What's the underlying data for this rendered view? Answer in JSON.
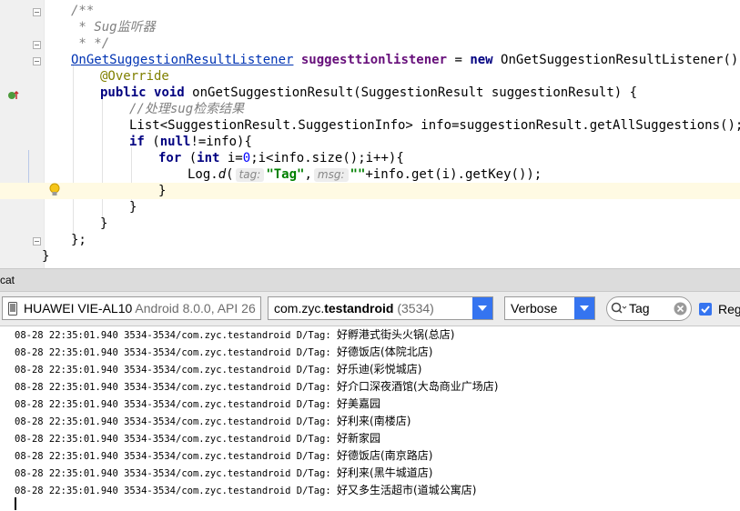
{
  "editor": {
    "comment_open": "/**",
    "comment_mid": " * Sug监听器",
    "comment_close": " * */",
    "l4_type": "OnGetSuggestionResultListener",
    "l4_field": "suggesttionlistener",
    "l4_eq": " = ",
    "l4_new": "new",
    "l4_rest": " OnGetSuggestionResultListener() {",
    "l5_annotation": "@Override",
    "l6_public": "public",
    "l6_void": "void",
    "l6_rest": " onGetSuggestionResult(SuggestionResult suggestionResult) {",
    "l7_comment": "//处理sug检索结果",
    "l8_text": "List<SuggestionResult.SuggestionInfo> info=suggestionResult.getAllSuggestions();",
    "l9_if": "if",
    "l9_null": "null",
    "l9_rest": "!=info){",
    "l9_open": " (",
    "l10_for": "for",
    "l10_int": "int",
    "l10_a": " (",
    "l10_b": " i=",
    "l10_zero": "0",
    "l10_c": ";i<info.size();i++){",
    "l11_a": "Log.",
    "l11_d": "d",
    "l11_paren": "(",
    "l11_hint_tag": "tag:",
    "l11_tag": "\"Tag\"",
    "l11_comma": ",",
    "l11_hint_msg": "msg:",
    "l11_empty": "\"\"",
    "l11_rest": "+info.get(i).getKey());",
    "l12": "}",
    "l13": "}",
    "l14": "}",
    "l15": "};",
    "l16": "}"
  },
  "logcat": {
    "title": "cat",
    "device": {
      "name": "HUAWEI VIE-AL10",
      "detail": "Android 8.0.0, API 26"
    },
    "process": {
      "prefix": "com.zyc.",
      "bold": "testandroid",
      "pid": "(3534)"
    },
    "level": "Verbose",
    "search": {
      "value": "Tag"
    },
    "regex_label": "Regex",
    "lines": [
      {
        "meta": "08-28 22:35:01.940 3534-3534/com.zyc.testandroid D/Tag: ",
        "msg": "好孵港式街头火锅(总店)"
      },
      {
        "meta": "08-28 22:35:01.940 3534-3534/com.zyc.testandroid D/Tag: ",
        "msg": "好德饭店(体院北店)"
      },
      {
        "meta": "08-28 22:35:01.940 3534-3534/com.zyc.testandroid D/Tag: ",
        "msg": "好乐迪(彩悦城店)"
      },
      {
        "meta": "08-28 22:35:01.940 3534-3534/com.zyc.testandroid D/Tag: ",
        "msg": "好介口深夜酒馆(大岛商业广场店)"
      },
      {
        "meta": "08-28 22:35:01.940 3534-3534/com.zyc.testandroid D/Tag: ",
        "msg": "好美嘉园"
      },
      {
        "meta": "08-28 22:35:01.940 3534-3534/com.zyc.testandroid D/Tag: ",
        "msg": "好利来(南楼店)"
      },
      {
        "meta": "08-28 22:35:01.940 3534-3534/com.zyc.testandroid D/Tag: ",
        "msg": "好新家园"
      },
      {
        "meta": "08-28 22:35:01.940 3534-3534/com.zyc.testandroid D/Tag: ",
        "msg": "好德饭店(南京路店)"
      },
      {
        "meta": "08-28 22:35:01.940 3534-3534/com.zyc.testandroid D/Tag: ",
        "msg": "好利来(黑牛城道店)"
      },
      {
        "meta": "08-28 22:35:01.940 3534-3534/com.zyc.testandroid D/Tag: ",
        "msg": "好又多生活超市(道城公寓店)"
      }
    ]
  },
  "colors": {
    "accent": "#3574f0",
    "keyword": "#000080",
    "string": "#008000",
    "annotation": "#808000",
    "field": "#660e7a",
    "current_line": "#fffae3"
  },
  "icons": [
    "phone-icon",
    "search-icon",
    "clear-icon",
    "lightbulb-icon",
    "override-gutter-icon",
    "fold-icon",
    "checkbox-checked-icon",
    "dropdown-arrow-icon"
  ]
}
